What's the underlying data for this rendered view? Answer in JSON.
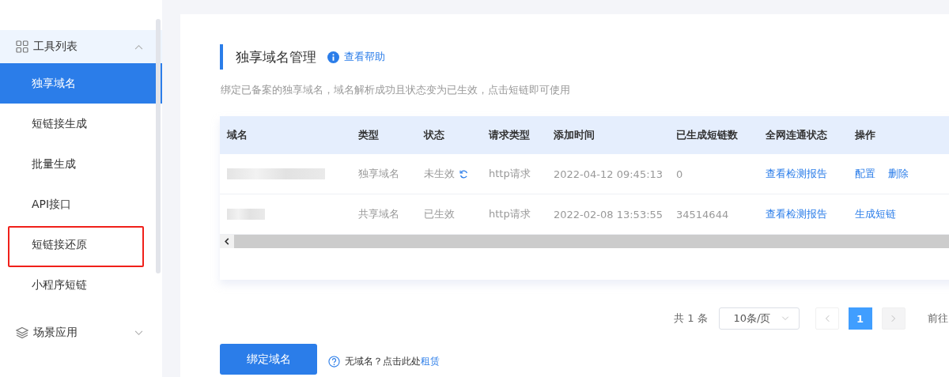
{
  "sidebar": {
    "groups": [
      {
        "label": "工具列表",
        "expanded": true,
        "items": [
          {
            "label": "独享域名",
            "selected": true,
            "annotated": false
          },
          {
            "label": "短链接生成",
            "selected": false,
            "annotated": false
          },
          {
            "label": "批量生成",
            "selected": false,
            "annotated": false
          },
          {
            "label": "API接口",
            "selected": false,
            "annotated": false
          },
          {
            "label": "短链接还原",
            "selected": false,
            "annotated": true
          },
          {
            "label": "小程序短链",
            "selected": false,
            "annotated": false
          }
        ]
      },
      {
        "label": "场景应用",
        "expanded": false
      }
    ]
  },
  "page": {
    "title": "独享域名管理",
    "help_link": "查看帮助",
    "description": "绑定已备案的独享域名，域名解析成功且状态变为已生效，点击短链即可使用"
  },
  "table": {
    "columns": [
      "域名",
      "类型",
      "状态",
      "请求类型",
      "添加时间",
      "已生成短链数",
      "全网连通状态",
      "操作"
    ],
    "rows": [
      {
        "type": "独享域名",
        "status": "未生效",
        "pending": true,
        "request_type": "http请求",
        "added": "2022-04-12 09:45:13",
        "count": "0",
        "report": "查看检测报告",
        "actions": [
          "配置",
          "删除"
        ]
      },
      {
        "type": "共享域名",
        "status": "已生效",
        "pending": false,
        "request_type": "http请求",
        "added": "2022-02-08 13:53:55",
        "count": "34514644",
        "report": "查看检测报告",
        "actions": [
          "生成短链"
        ]
      }
    ]
  },
  "pagination": {
    "total": "共 1 条",
    "page_size": "10条/页",
    "pages": [
      {
        "label": "1",
        "selected": true
      }
    ],
    "goto": "前往"
  },
  "bind_button": "绑定域名",
  "hint": {
    "text": "无域名？点击此处",
    "link": "租赁"
  }
}
